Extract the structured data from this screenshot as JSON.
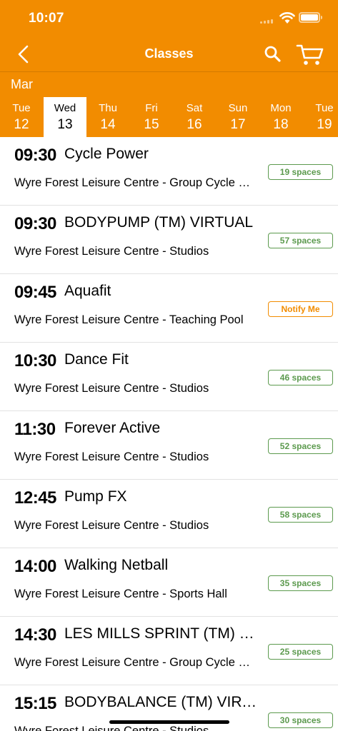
{
  "status_bar": {
    "time": "10:07"
  },
  "nav": {
    "title": "Classes"
  },
  "calendar": {
    "month": "Mar",
    "days": [
      {
        "name": "Tue",
        "date": "12"
      },
      {
        "name": "Wed",
        "date": "13"
      },
      {
        "name": "Thu",
        "date": "14"
      },
      {
        "name": "Fri",
        "date": "15"
      },
      {
        "name": "Sat",
        "date": "16"
      },
      {
        "name": "Sun",
        "date": "17"
      },
      {
        "name": "Mon",
        "date": "18"
      },
      {
        "name": "Tue",
        "date": "19"
      }
    ],
    "selected_day": "Wed 13"
  },
  "classes": [
    {
      "time": "09:30",
      "name": "Cycle Power",
      "venue": "Wyre Forest Leisure Centre - Group Cycle Studio",
      "status": "19 spaces"
    },
    {
      "time": "09:30",
      "name": "BODYPUMP (TM) VIRTUAL",
      "venue": "Wyre Forest Leisure Centre - Studios",
      "status": "57 spaces"
    },
    {
      "time": "09:45",
      "name": "Aquafit",
      "venue": "Wyre Forest Leisure Centre - Teaching Pool",
      "status": "Notify Me"
    },
    {
      "time": "10:30",
      "name": "Dance Fit",
      "venue": "Wyre Forest Leisure Centre - Studios",
      "status": "46 spaces"
    },
    {
      "time": "11:30",
      "name": "Forever Active",
      "venue": "Wyre Forest Leisure Centre - Studios",
      "status": "52 spaces"
    },
    {
      "time": "12:45",
      "name": "Pump FX",
      "venue": "Wyre Forest Leisure Centre - Studios",
      "status": "58 spaces"
    },
    {
      "time": "14:00",
      "name": "Walking Netball",
      "venue": "Wyre Forest Leisure Centre - Sports Hall",
      "status": "35 spaces"
    },
    {
      "time": "14:30",
      "name": "LES MILLS SPRINT (TM) VIRTUAL",
      "venue": "Wyre Forest Leisure Centre - Group Cycle Studio",
      "status": "25 spaces"
    },
    {
      "time": "15:15",
      "name": "BODYBALANCE (TM) VIRTUAL",
      "venue": "Wyre Forest Leisure Centre - Studios",
      "status": "30 spaces"
    }
  ],
  "colors": {
    "brand": "#F28C00",
    "available": "#5c9a4e",
    "notify": "#F28C00"
  },
  "icons": {
    "back": "chevron-left-icon",
    "search": "search-icon",
    "cart": "cart-icon"
  }
}
